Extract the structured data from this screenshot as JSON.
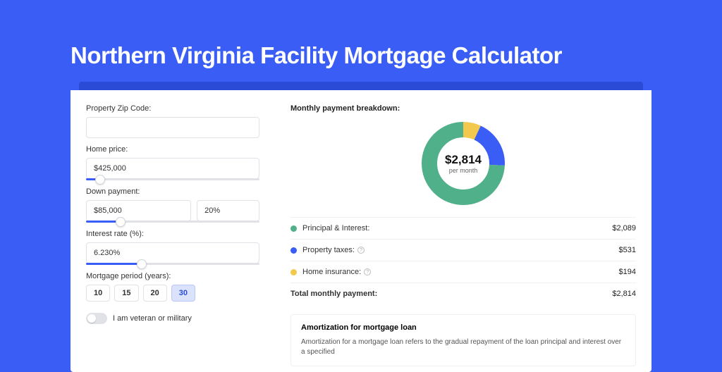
{
  "title": "Northern Virginia Facility Mortgage Calculator",
  "colors": {
    "principal": "#4fb08a",
    "taxes": "#3a5df5",
    "insurance": "#f2c94c"
  },
  "form": {
    "zip_label": "Property Zip Code:",
    "zip_value": "",
    "price_label": "Home price:",
    "price_value": "$425,000",
    "price_slider_pct": 8,
    "down_label": "Down payment:",
    "down_value": "$85,000",
    "down_pct": "20%",
    "down_slider_pct": 20,
    "rate_label": "Interest rate (%):",
    "rate_value": "6.230%",
    "rate_slider_pct": 32,
    "period_label": "Mortgage period (years):",
    "periods": [
      "10",
      "15",
      "20",
      "30"
    ],
    "period_active": "30",
    "veteran_label": "I am veteran or military"
  },
  "breakdown": {
    "title": "Monthly payment breakdown:",
    "donut_value": "$2,814",
    "donut_sub": "per month",
    "items": [
      {
        "label": "Principal & Interest:",
        "value": "$2,089",
        "color_key": "principal",
        "info": false
      },
      {
        "label": "Property taxes:",
        "value": "$531",
        "color_key": "taxes",
        "info": true
      },
      {
        "label": "Home insurance:",
        "value": "$194",
        "color_key": "insurance",
        "info": true
      }
    ],
    "total_label": "Total monthly payment:",
    "total_value": "$2,814"
  },
  "chart_data": {
    "type": "pie",
    "title": "Monthly payment breakdown",
    "series": [
      {
        "name": "Principal & Interest",
        "value": 2089
      },
      {
        "name": "Property taxes",
        "value": 531
      },
      {
        "name": "Home insurance",
        "value": 194
      }
    ],
    "total": 2814,
    "unit": "USD/month"
  },
  "amort": {
    "title": "Amortization for mortgage loan",
    "body": "Amortization for a mortgage loan refers to the gradual repayment of the loan principal and interest over a specified"
  }
}
